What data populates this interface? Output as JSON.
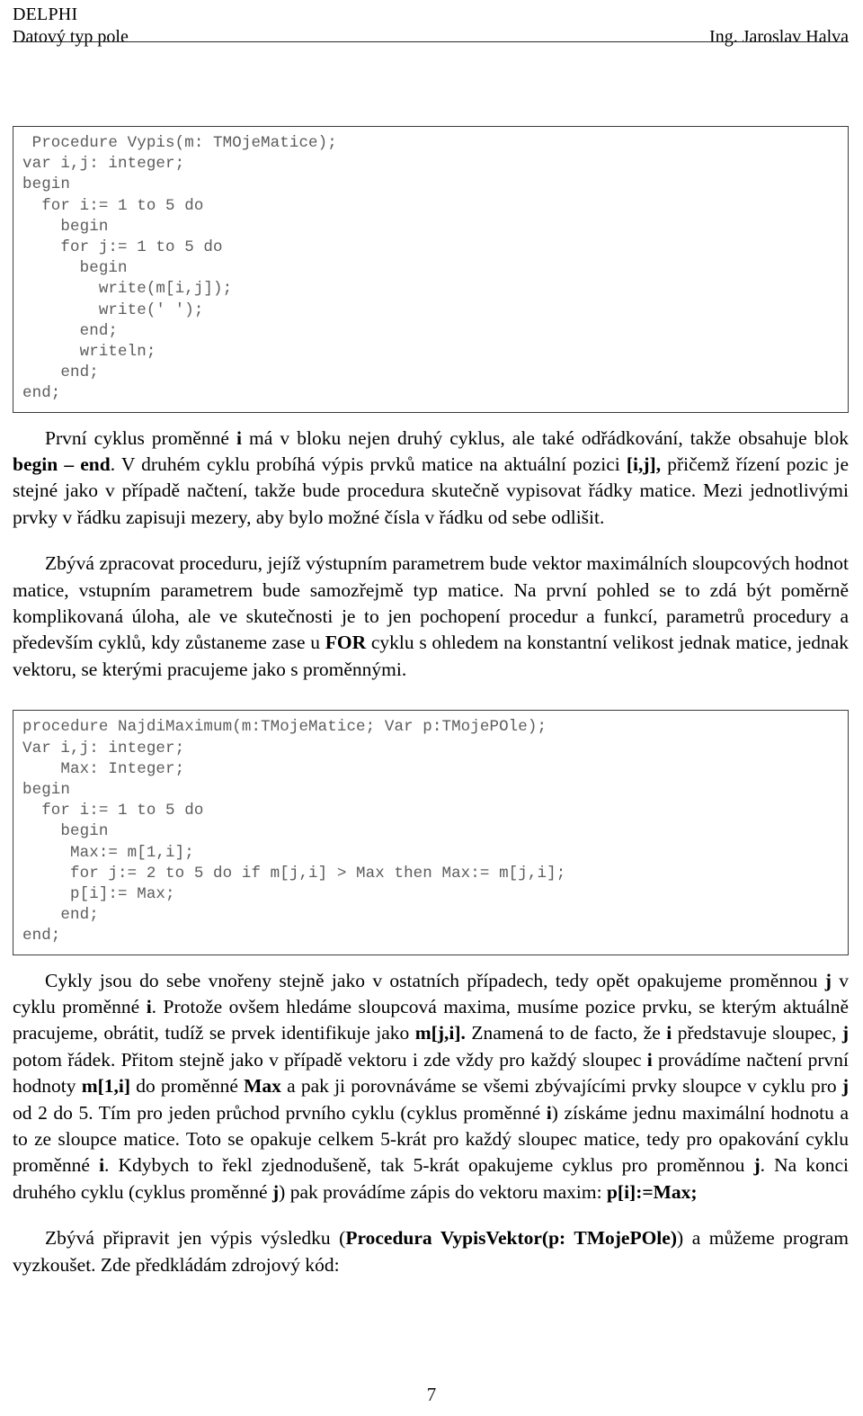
{
  "header": {
    "course": "DELPHI",
    "subtitle": "Datový typ pole",
    "author": "Ing. Jaroslav Halva"
  },
  "code_blocks": [
    {
      "name": "vypis-procedure",
      "text": " Procedure Vypis(m: TMOjeMatice);\nvar i,j: integer;\nbegin\n  for i:= 1 to 5 do\n    begin\n    for j:= 1 to 5 do\n      begin\n        write(m[i,j]);\n        write(' ');\n      end;\n      writeln;\n    end;\nend;"
    },
    {
      "name": "najdimaximum-procedure",
      "text": "procedure NajdiMaximum(m:TMojeMatice; Var p:TMojePOle);\nVar i,j: integer;\n    Max: Integer;\nbegin\n  for i:= 1 to 5 do\n    begin\n     Max:= m[1,i];\n     for j:= 2 to 5 do if m[j,i] > Max then Max:= m[j,i];\n     p[i]:= Max;\n    end;\nend;"
    }
  ],
  "paragraphs": {
    "p1": {
      "s1": "První cyklus proměnné ",
      "b1": "i",
      "s2": " má v bloku nejen druhý cyklus, ale také odřádkování, takže obsahuje blok ",
      "b2": "begin – end",
      "s3": ". V druhém cyklu probíhá výpis prvků matice na aktuální pozici ",
      "b3": "[i,j],",
      "s4": " přičemž řízení pozic je stejné jako v případě načtení, takže bude procedura skutečně vypisovat řádky matice. Mezi jednotlivými prvky v řádku zapisuji mezery, aby bylo možné čísla v řádku od sebe odlišit."
    },
    "p2": {
      "s1": "Zbývá zpracovat proceduru, jejíž výstupním parametrem bude vektor maximálních sloupcových hodnot matice, vstupním parametrem bude samozřejmě typ matice. Na první pohled se to zdá být poměrně komplikovaná úloha, ale ve skutečnosti je to jen pochopení procedur a funkcí, parametrů procedury a především cyklů, kdy zůstaneme zase u ",
      "b1": "FOR",
      "s2": " cyklu s ohledem na konstantní velikost jednak matice, jednak vektoru, se kterými pracujeme jako s proměnnými."
    },
    "p3": {
      "s1": "Cykly jsou do sebe vnořeny stejně jako v ostatních případech, tedy opět opakujeme proměnnou ",
      "b1": "j",
      "s2": " v cyklu proměnné ",
      "b2": "i",
      "s3": ". Protože ovšem hledáme sloupcová maxima, musíme pozice prvku, se kterým aktuálně pracujeme, obrátit, tudíž se prvek identifikuje jako ",
      "b3": "m[j,i].",
      "s4": " Znamená to de facto, že ",
      "b4": "i",
      "s5": " představuje sloupec, ",
      "b5": "j",
      "s6": " potom řádek. Přitom stejně jako v případě vektoru i zde vždy pro každý sloupec ",
      "b6": "i",
      "s7": " provádíme načtení první hodnoty ",
      "b7": "m[1,i]",
      "s8": " do proměnné ",
      "b8": "Max",
      "s9": " a pak ji porovnáváme se všemi zbývajícími prvky sloupce v cyklu pro ",
      "b9": "j",
      "s10": " od 2 do 5. Tím pro jeden průchod prvního cyklu (cyklus proměnné ",
      "b10": "i",
      "s11": ") získáme jednu maximální hodnotu a to ze sloupce matice. Toto se opakuje celkem 5-krát pro každý sloupec matice, tedy pro opakování cyklu proměnné ",
      "b11": "i",
      "s12": ". Kdybych to řekl zjednodušeně, tak 5-krát opakujeme cyklus pro proměnnou ",
      "b12": "j",
      "s13": ". Na konci druhého cyklu (cyklus proměnné ",
      "b13": "j",
      "s14": ") pak provádíme zápis do vektoru maxim: ",
      "b14": "p[i]:=Max;"
    },
    "p4": {
      "s1": "Zbývá připravit jen výpis výsledku (",
      "b1": "Procedura VypisVektor(p: TMojePOle)",
      "s2": ") a můžeme program vyzkoušet. Zde předkládám zdrojový kód:"
    }
  },
  "footer": {
    "page_number": "7"
  }
}
